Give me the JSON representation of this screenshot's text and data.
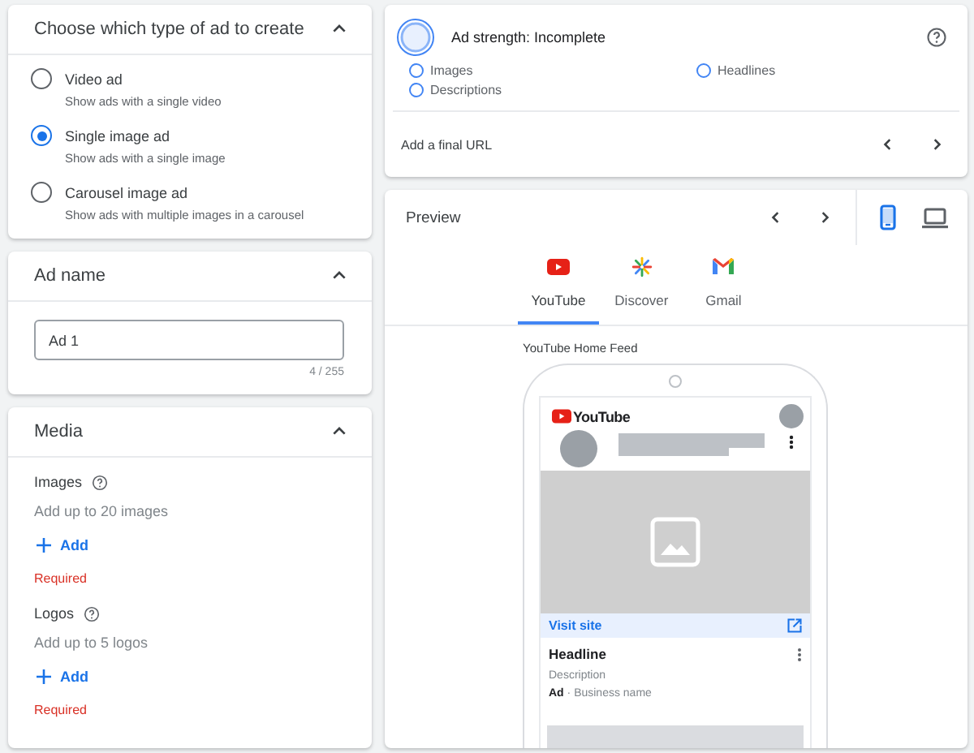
{
  "ad_type": {
    "title": "Choose which type of ad to create",
    "expanded": true,
    "options": [
      {
        "label": "Video ad",
        "description": "Show ads with a single video",
        "selected": false
      },
      {
        "label": "Single image ad",
        "description": "Show ads with a single image",
        "selected": true
      },
      {
        "label": "Carousel image ad",
        "description": "Show ads with multiple images in a carousel",
        "selected": false
      }
    ]
  },
  "ad_name": {
    "title": "Ad name",
    "expanded": true,
    "value": "Ad 1",
    "counter": "4 / 255"
  },
  "media": {
    "title": "Media",
    "expanded": true,
    "sections": [
      {
        "label": "Images",
        "hint": "Add up to 20 images",
        "add": "Add",
        "error": "Required"
      },
      {
        "label": "Logos",
        "hint": "Add up to 5 logos",
        "add": "Add",
        "error": "Required"
      }
    ]
  },
  "ad_strength": {
    "title": "Ad strength: Incomplete",
    "checklist": [
      {
        "label": "Images",
        "checked": false
      },
      {
        "label": "Headlines",
        "checked": false
      },
      {
        "label": "Descriptions",
        "checked": false
      }
    ],
    "final_url": "Add a final URL"
  },
  "preview": {
    "title": "Preview",
    "devices": [
      {
        "kind": "mobile",
        "selected": true
      },
      {
        "kind": "desktop",
        "selected": false
      }
    ],
    "tabs": [
      {
        "kind": "youtube",
        "label": "YouTube",
        "selected": true
      },
      {
        "kind": "discover",
        "label": "Discover",
        "selected": false
      },
      {
        "kind": "gmail",
        "label": "Gmail",
        "selected": false
      }
    ],
    "feed_label": "YouTube Home Feed",
    "ad": {
      "app_logo": "YouTube",
      "cta": "Visit site",
      "headline": "Headline",
      "description": "Description",
      "byline": "**Ad** · Business name"
    }
  }
}
